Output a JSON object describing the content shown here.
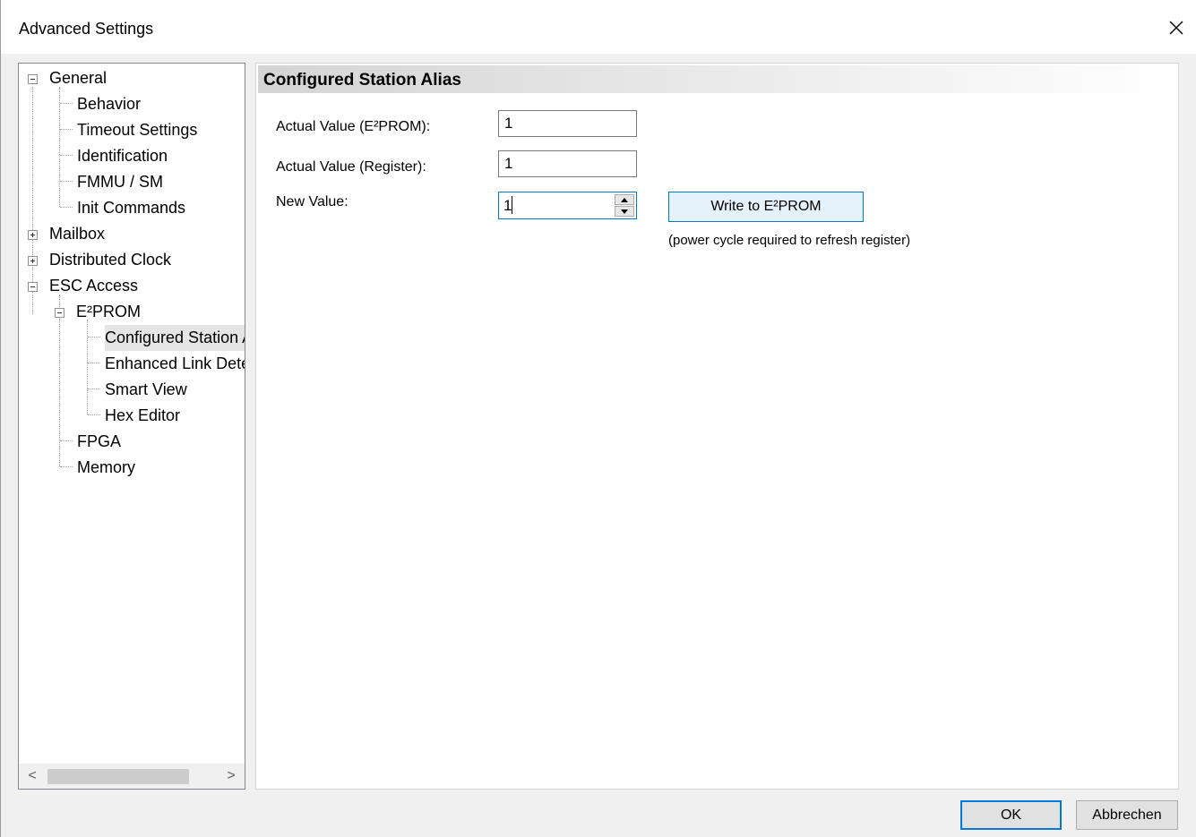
{
  "window": {
    "title": "Advanced Settings"
  },
  "tree": {
    "items": [
      {
        "label": "General",
        "expander": "minus"
      },
      {
        "label": "Behavior"
      },
      {
        "label": "Timeout Settings"
      },
      {
        "label": "Identification"
      },
      {
        "label": "FMMU / SM"
      },
      {
        "label": "Init Commands"
      },
      {
        "label": "Mailbox",
        "expander": "plus"
      },
      {
        "label": "Distributed Clock",
        "expander": "plus"
      },
      {
        "label": "ESC Access",
        "expander": "minus"
      },
      {
        "label": "E²PROM",
        "expander": "minus"
      },
      {
        "label": "Configured Station Alias",
        "selected": true
      },
      {
        "label": "Enhanced Link Detection"
      },
      {
        "label": "Smart View"
      },
      {
        "label": "Hex Editor"
      },
      {
        "label": "FPGA"
      },
      {
        "label": "Memory"
      }
    ],
    "scroll_left": "<",
    "scroll_right": ">"
  },
  "section": {
    "title": "Configured Station Alias",
    "actual_eeprom_label": "Actual Value (E²PROM):",
    "actual_eeprom_value": "1",
    "actual_register_label": "Actual Value (Register):",
    "actual_register_value": "1",
    "new_value_label": "New Value:",
    "new_value": "1",
    "write_button": "Write to E²PROM",
    "hint": "(power cycle required to refresh register)"
  },
  "footer": {
    "ok": "OK",
    "cancel": "Abbrechen"
  }
}
